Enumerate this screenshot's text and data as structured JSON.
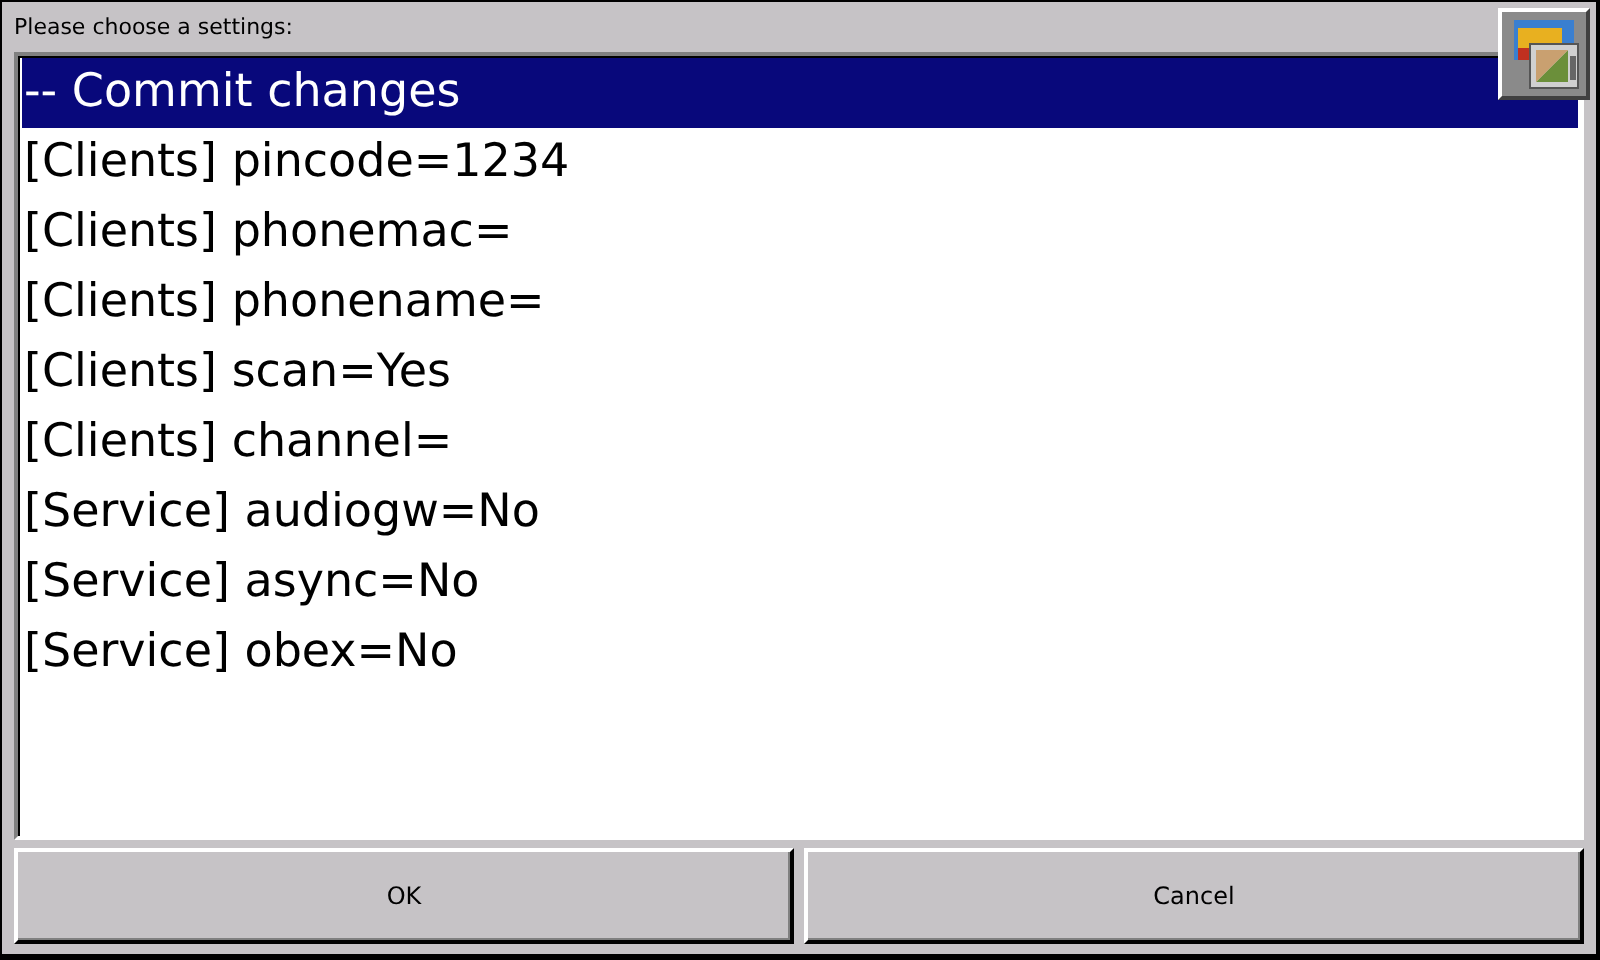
{
  "prompt": "Please choose a settings:",
  "items": [
    {
      "label": "-- Commit changes",
      "selected": true
    },
    {
      "label": "[Clients] pincode=1234",
      "selected": false
    },
    {
      "label": "[Clients] phonemac=",
      "selected": false
    },
    {
      "label": "[Clients] phonename=",
      "selected": false
    },
    {
      "label": "[Clients] scan=Yes",
      "selected": false
    },
    {
      "label": "[Clients] channel=",
      "selected": false
    },
    {
      "label": "[Service] audiogw=No",
      "selected": false
    },
    {
      "label": "[Service] async=No",
      "selected": false
    },
    {
      "label": "[Service] obex=No",
      "selected": false
    }
  ],
  "buttons": [
    "OK",
    "Cancel"
  ]
}
